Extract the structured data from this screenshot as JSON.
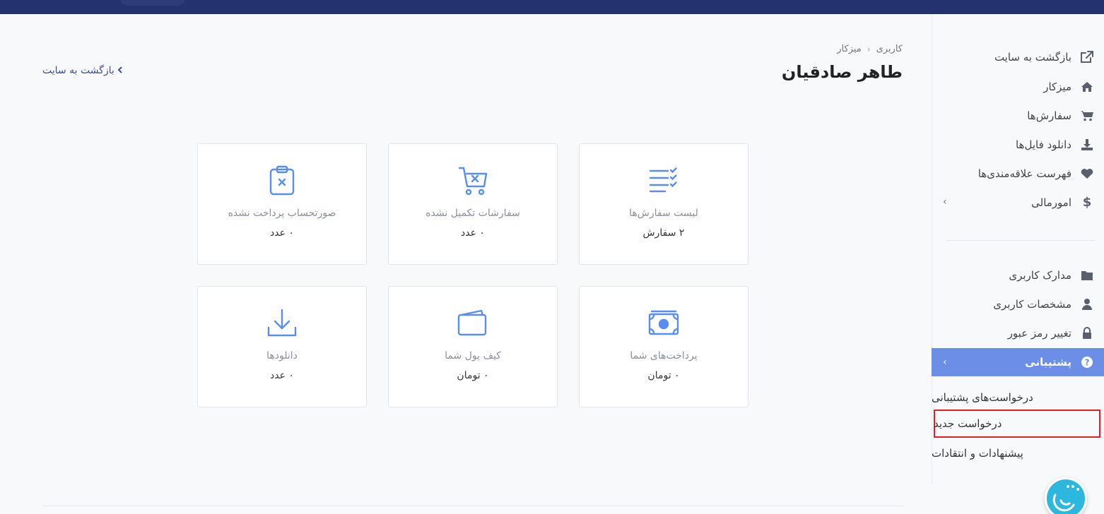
{
  "header": {
    "breadcrumb": [
      "کاربری",
      "میزکار"
    ],
    "breadcrumb_sep": "‹",
    "title": "طاهر صادقیان",
    "back_link": "بازگشت به سایت"
  },
  "sidebar": {
    "items": [
      {
        "label": "بازگشت به سایت",
        "icon": "external-link-icon"
      },
      {
        "label": "میزکار",
        "icon": "home-icon"
      },
      {
        "label": "سفارش‌ها",
        "icon": "cart-icon"
      },
      {
        "label": "دانلود فایل‌ها",
        "icon": "download-icon"
      },
      {
        "label": "فهرست علاقه‌مندی‌ها",
        "icon": "heart-icon"
      },
      {
        "label": "امورمالی",
        "icon": "dollar-icon"
      },
      {
        "label": "مدارک کاربری",
        "icon": "folder-icon"
      },
      {
        "label": "مشخصات کاربری",
        "icon": "user-icon"
      },
      {
        "label": "تغییر رمز عبور",
        "icon": "lock-icon"
      },
      {
        "label": "پشتیبانی",
        "icon": "question-icon"
      }
    ],
    "sub_items": [
      "درخواست‌های پشتیبانی",
      "درخواست جدید",
      "پیشنهادات و انتقادات"
    ],
    "chevron": "‹"
  },
  "cards": [
    {
      "title": "لیست سفارش‌ها",
      "value": "۲ سفارش",
      "icon": "checklist-icon"
    },
    {
      "title": "سفارشات تکمیل نشده",
      "value": "۰ عدد",
      "icon": "cart-x-icon"
    },
    {
      "title": "صورتحساب پرداخت نشده",
      "value": "۰ عدد",
      "icon": "clipboard-x-icon"
    },
    {
      "title": "پرداخت‌های شما",
      "value": "۰ تومان",
      "icon": "money-icon"
    },
    {
      "title": "کیف پول شما",
      "value": "۰ تومان",
      "icon": "wallet-icon"
    },
    {
      "title": "دانلودها",
      "value": "۰ عدد",
      "icon": "download-tray-icon"
    }
  ],
  "colors": {
    "topbar": "#24326f",
    "accent": "#6c8ee6",
    "icon_blue": "#5b8def",
    "highlight_border": "#e21f26"
  }
}
